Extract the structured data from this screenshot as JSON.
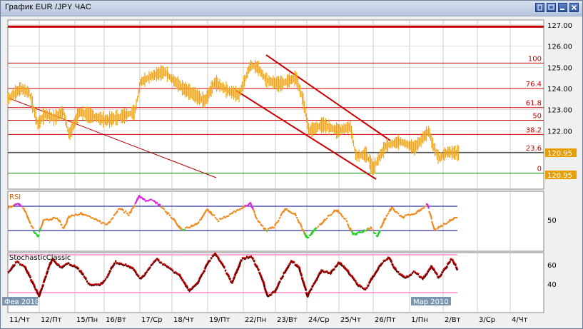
{
  "window": {
    "title": "График EUR /JPY  ЧАС"
  },
  "price_axis": {
    "ticks": [
      "127.00",
      "126.00",
      "125.00",
      "124.00",
      "123.00",
      "122.00",
      "121.00"
    ]
  },
  "fib_labels": [
    "100",
    "76.4",
    "61.8",
    "50",
    "38.2",
    "23.6",
    "0"
  ],
  "price_badges": [
    "120.95",
    "120.95"
  ],
  "rsi": {
    "label": "RSI",
    "tick": "50"
  },
  "stoch": {
    "label": "StochasticClassic",
    "ticks": [
      "60",
      "40"
    ]
  },
  "month_badges": [
    "Фев 2010",
    "Мар 2010"
  ],
  "time_axis": [
    "11/Чт",
    "12/Пт",
    "15/Пн",
    "16/Вт",
    "17/Ср",
    "18/Чт",
    "19/Пт",
    "22/Пн",
    "23/Вт",
    "24/Ср",
    "25/Чт",
    "26/Пт",
    "1/Пн",
    "2/Вт",
    "3/Ср",
    "4/Чт"
  ],
  "colors": {
    "price": "#f0a418",
    "fib": "#cc0000",
    "rsi": "#f08a1c",
    "rsi_high": "#e020e0",
    "rsi_low": "#20d020",
    "stoch": "#c80000",
    "stoch_band": "#ff8ac8",
    "band": "#00008c"
  },
  "chart_data": {
    "type": "line",
    "title": "График EUR /JPY  ЧАС",
    "x": [
      "11/Чт",
      "12/Пт",
      "15/Пн",
      "16/Вт",
      "17/Ср",
      "18/Чт",
      "19/Пт",
      "22/Пн",
      "23/Вт",
      "24/Ср",
      "25/Чт",
      "26/Пт",
      "1/Пн",
      "2/Вт"
    ],
    "series": [
      {
        "name": "EUR/JPY",
        "values": [
          123.7,
          122.5,
          122.9,
          122.6,
          124.7,
          124.0,
          124.3,
          125.1,
          124.1,
          122.1,
          122.2,
          120.3,
          121.5,
          120.9
        ]
      }
    ],
    "ylim": [
      120.0,
      127.4
    ],
    "last_price": 120.95
  }
}
